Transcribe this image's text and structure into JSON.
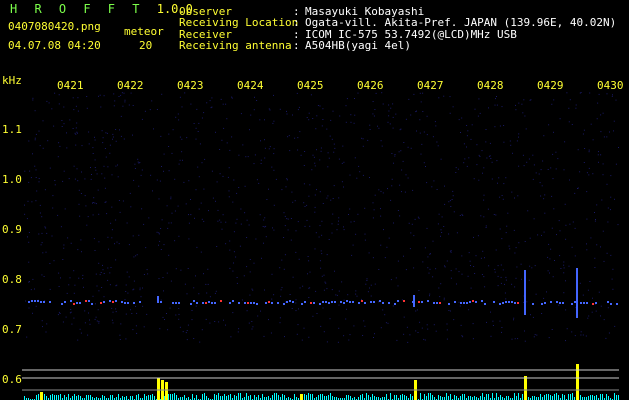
{
  "app": {
    "title": "H R O F F T",
    "version": "1.0.0",
    "filename": "0407080420.png",
    "datetime": "04.07.08 04:20",
    "meteor_label": "meteor",
    "meteor_count": "20"
  },
  "info": [
    {
      "label": "Observer",
      "sep": ":",
      "value": "Masayuki Kobayashi"
    },
    {
      "label": "Receiving Location",
      "sep": ":",
      "value": "Ogata-vill. Akita-Pref. JAPAN (139.96E, 40.02N)"
    },
    {
      "label": "Receiver",
      "sep": ":",
      "value": "ICOM IC-575 53.7492(@LCD)MHz USB"
    },
    {
      "label": "Receiving antenna",
      "sep": ":",
      "value": "A504HB(yagi 4el)"
    }
  ],
  "spectrogram": {
    "unit_label": "kHz",
    "time_labels": [
      "0421",
      "0422",
      "0423",
      "0424",
      "0425",
      "0426",
      "0427",
      "0428",
      "0429",
      "0430"
    ],
    "freq_labels": [
      "1.1",
      "1.0",
      "0.9",
      "0.8",
      "0.7",
      "0.6"
    ],
    "colors": {
      "background": "#000000",
      "noise": "#1a1a66",
      "trace": "#4466ff",
      "hot": "#ff3333",
      "label": "#ffff33",
      "grid": "#cccccc",
      "power_bars": "#00ffff",
      "power_peaks": "#ffff00"
    }
  }
}
